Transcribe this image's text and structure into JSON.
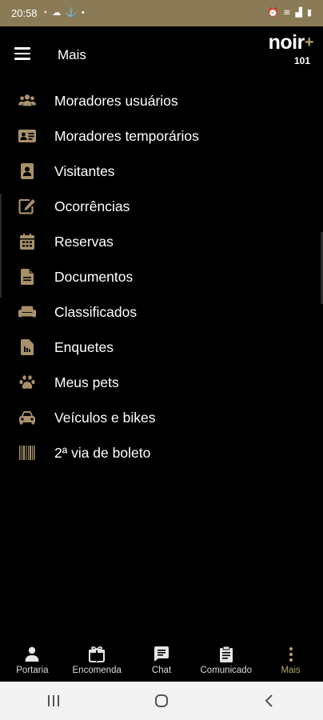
{
  "status": {
    "time": "20:58"
  },
  "appbar": {
    "title": "Mais",
    "brand": "noir",
    "brand_plus": "+",
    "unit": "101"
  },
  "colors": {
    "accent": "#a8916a",
    "statusbar": "#8a7a55",
    "background": "#000000"
  },
  "menu": [
    {
      "label": "Moradores usuários",
      "icon": "users-icon"
    },
    {
      "label": "Moradores temporários",
      "icon": "id-card-icon"
    },
    {
      "label": "Visitantes",
      "icon": "address-book-icon"
    },
    {
      "label": "Ocorrências",
      "icon": "edit-icon"
    },
    {
      "label": "Reservas",
      "icon": "calendar-icon"
    },
    {
      "label": "Documentos",
      "icon": "document-icon"
    },
    {
      "label": "Classificados",
      "icon": "couch-icon"
    },
    {
      "label": "Enquetes",
      "icon": "poll-icon"
    },
    {
      "label": "Meus pets",
      "icon": "paw-icon"
    },
    {
      "label": "Veículos e bikes",
      "icon": "car-icon"
    },
    {
      "label": "2ª via de boleto",
      "icon": "barcode-icon"
    }
  ],
  "bottomnav": [
    {
      "label": "Portaria",
      "icon": "person-icon"
    },
    {
      "label": "Encomenda",
      "icon": "package-icon"
    },
    {
      "label": "Chat",
      "icon": "chat-icon"
    },
    {
      "label": "Comunicado",
      "icon": "clipboard-icon"
    },
    {
      "label": "Mais",
      "icon": "more-vertical-icon",
      "active": true
    }
  ]
}
